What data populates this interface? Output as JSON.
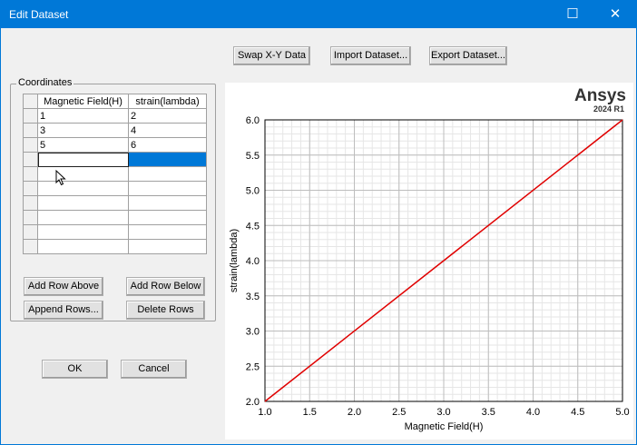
{
  "window": {
    "title": "Edit Dataset"
  },
  "toolbar": {
    "swap_label": "Swap X-Y Data",
    "import_label": "Import Dataset...",
    "export_label": "Export Dataset..."
  },
  "coordinates": {
    "group_label": "Coordinates",
    "columns": [
      "Magnetic Field(H)",
      "strain(lambda)"
    ],
    "rows": [
      [
        "1",
        "2"
      ],
      [
        "3",
        "4"
      ],
      [
        "5",
        "6"
      ],
      [
        "",
        ""
      ],
      [
        "",
        ""
      ],
      [
        "",
        ""
      ],
      [
        "",
        ""
      ],
      [
        "",
        ""
      ],
      [
        "",
        ""
      ],
      [
        "",
        ""
      ]
    ]
  },
  "row_buttons": {
    "add_above": "Add Row Above",
    "add_below": "Add Row Below",
    "append": "Append Rows...",
    "delete": "Delete Rows"
  },
  "dialog_buttons": {
    "ok": "OK",
    "cancel": "Cancel"
  },
  "brand": {
    "name": "Ansys",
    "version": "2024 R1"
  },
  "chart_data": {
    "type": "line",
    "x": [
      1,
      3,
      5
    ],
    "series": [
      {
        "values": [
          2,
          4,
          6
        ],
        "color": "#e00000"
      }
    ],
    "xlabel": "Magnetic Field(H)",
    "ylabel": "strain(lambda)",
    "xlim": [
      1.0,
      5.0
    ],
    "ylim": [
      2.0,
      6.0
    ],
    "xticks": [
      "1.0",
      "1.5",
      "2.0",
      "2.5",
      "3.0",
      "3.5",
      "4.0",
      "4.5",
      "5.0"
    ],
    "yticks": [
      "2.0",
      "2.5",
      "3.0",
      "3.5",
      "4.0",
      "4.5",
      "5.0",
      "5.5",
      "6.0"
    ],
    "grid": true
  }
}
